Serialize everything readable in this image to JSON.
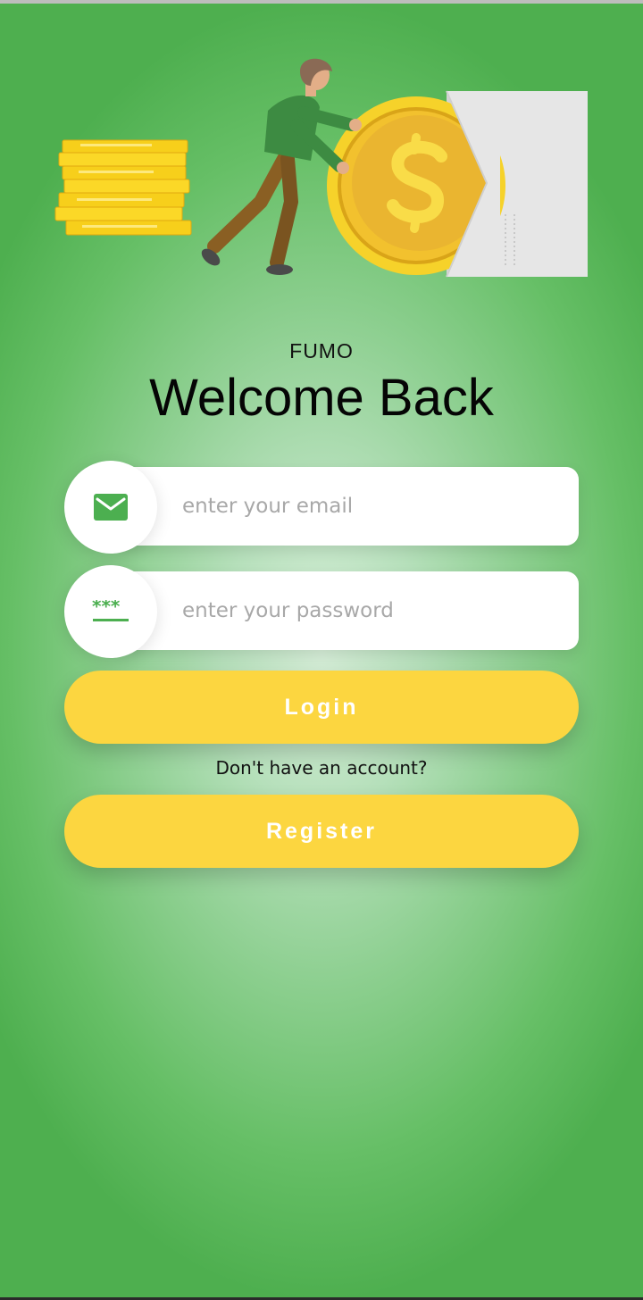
{
  "app": {
    "brand": "FUMO",
    "welcome_title": "Welcome Back"
  },
  "form": {
    "email": {
      "placeholder": "enter your email",
      "value": "",
      "icon": "envelope-icon"
    },
    "password": {
      "placeholder": "enter your password",
      "value": "",
      "icon": "password-asterisks-icon"
    },
    "login_label": "Login",
    "account_prompt": "Don't have an account?",
    "register_label": "Register"
  },
  "colors": {
    "background_edge": "#4eaf4f",
    "background_center": "#d6eed8",
    "button": "#fcd640",
    "button_text": "#ffffff",
    "icon_green": "#4caf50",
    "coin_gold": "#f2c12e"
  },
  "illustration": {
    "name": "person-rolling-coin-illustration",
    "elements": [
      "coin-stack",
      "person",
      "dollar-coin",
      "wallet"
    ]
  }
}
